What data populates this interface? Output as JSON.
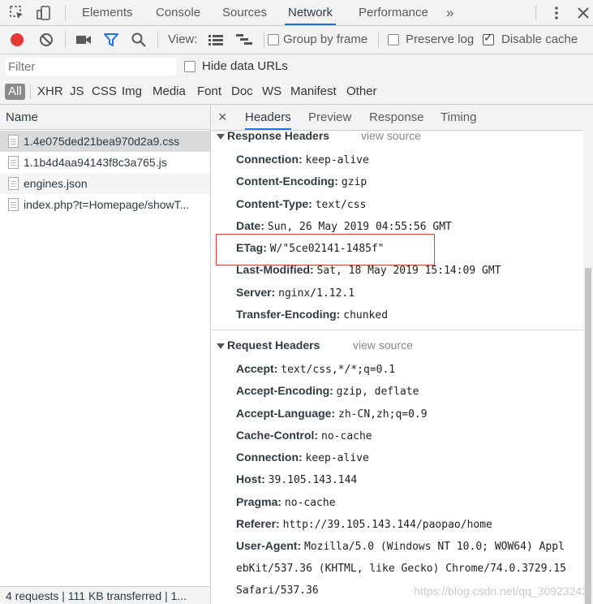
{
  "top_tabs": [
    "Elements",
    "Console",
    "Sources",
    "Network",
    "Performance"
  ],
  "active_tab": "Network",
  "overflow": "»",
  "toolbar": {
    "view_label": "View:",
    "group_by_frame": "Group by frame",
    "preserve_log": "Preserve log",
    "disable_cache": "Disable cache",
    "disable_cache_checked": true
  },
  "filter": {
    "placeholder": "Filter",
    "hide_data_urls": "Hide data URLs",
    "types": [
      "All",
      "XHR",
      "JS",
      "CSS",
      "Img",
      "Media",
      "Font",
      "Doc",
      "WS",
      "Manifest",
      "Other"
    ]
  },
  "list": {
    "header": "Name",
    "rows": [
      "1.4e075ded21bea970d2a9.css",
      "1.1b4d4aa94143f8c3a765.js",
      "engines.json",
      "index.php?t=Homepage/showT..."
    ],
    "status": "4 requests | 111 KB transferred | 1..."
  },
  "detail_tabs": [
    "Headers",
    "Preview",
    "Response",
    "Timing"
  ],
  "active_detail_tab": "Headers",
  "close_symbol": "×",
  "response_headers": {
    "title": "Response Headers",
    "view_source": "view source",
    "items": [
      {
        "name": "Connection:",
        "value": "keep-alive"
      },
      {
        "name": "Content-Encoding:",
        "value": "gzip"
      },
      {
        "name": "Content-Type:",
        "value": "text/css"
      },
      {
        "name": "Date:",
        "value": "Sun, 26 May 2019 04:55:56 GMT"
      },
      {
        "name": "ETag:",
        "value": "W/\"5ce02141-1485f\""
      },
      {
        "name": "Last-Modified:",
        "value": "Sat, 18 May 2019 15:14:09 GMT"
      },
      {
        "name": "Server:",
        "value": "nginx/1.12.1"
      },
      {
        "name": "Transfer-Encoding:",
        "value": "chunked"
      }
    ]
  },
  "request_headers": {
    "title": "Request Headers",
    "view_source": "view source",
    "items": [
      {
        "name": "Accept:",
        "value": "text/css,*/*;q=0.1"
      },
      {
        "name": "Accept-Encoding:",
        "value": "gzip, deflate"
      },
      {
        "name": "Accept-Language:",
        "value": "zh-CN,zh;q=0.9"
      },
      {
        "name": "Cache-Control:",
        "value": "no-cache"
      },
      {
        "name": "Connection:",
        "value": "keep-alive"
      },
      {
        "name": "Host:",
        "value": "39.105.143.144"
      },
      {
        "name": "Pragma:",
        "value": "no-cache"
      },
      {
        "name": "Referer:",
        "value": "http://39.105.143.144/paopao/home"
      },
      {
        "name": "User-Agent:",
        "value": "Mozilla/5.0 (Windows NT 10.0; WOW64) Appl"
      }
    ],
    "ua_line2": "ebKit/537.36 (KHTML, like Gecko) Chrome/74.0.3729.15",
    "ua_line3": "Safari/537.36"
  },
  "watermark": "https://blog.csdn.net/qq_30923243",
  "colors": {
    "accent": "#1a73e8",
    "record": "#e53935",
    "filter_icon": "#1a73e8",
    "highlight_box": "#d9413b"
  }
}
